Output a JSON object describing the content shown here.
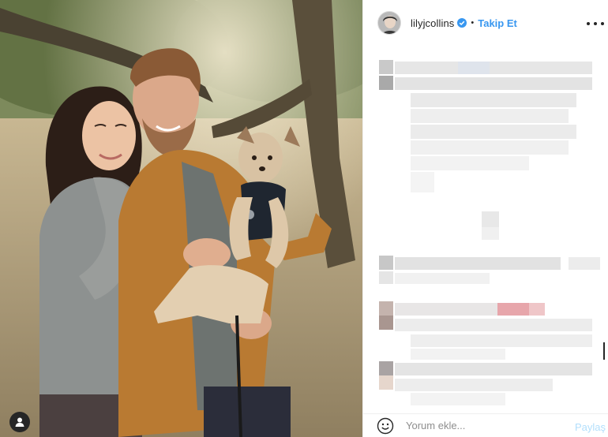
{
  "post": {
    "username": "lilyjcollins",
    "verified": true,
    "separator": "•",
    "follow_label": "Takip Et",
    "more_options_icon": "ellipsis-icon"
  },
  "photo": {
    "subject": "couple-with-dog-outdoor-photo",
    "tag_icon": "user-tag-icon"
  },
  "comments": {
    "censored": true
  },
  "comment_bar": {
    "emoji_icon": "smiley-face-icon",
    "placeholder": "Yorum ekle...",
    "share_label": "Paylaş"
  },
  "colors": {
    "link_blue": "#3897f0",
    "share_disabled": "#b2dffc",
    "text": "#262626",
    "placeholder": "#8e8e8e",
    "verified_badge": "#3897f0"
  }
}
